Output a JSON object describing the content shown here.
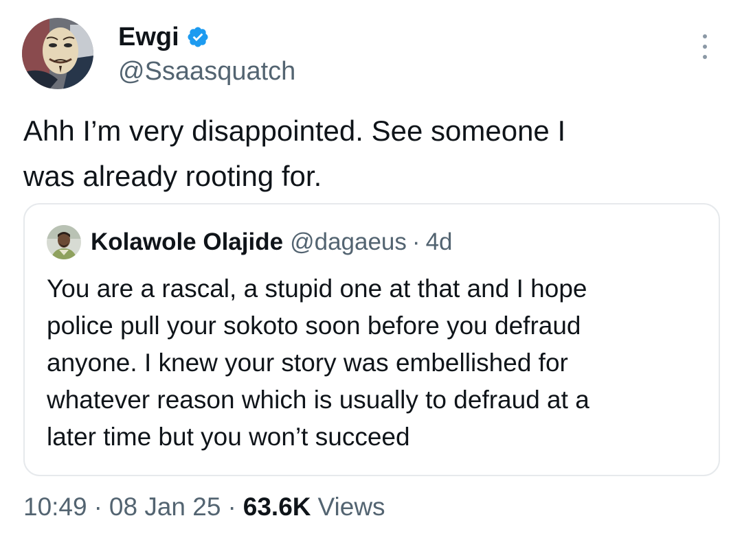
{
  "tweet": {
    "author": {
      "display_name": "Ewgi",
      "handle": "@Ssaasquatch",
      "verified": true,
      "avatar_icon": "guy-fawkes-mask-avatar"
    },
    "text_line1": "Ahh I’m very disappointed. See someone I",
    "text_line2": "was already rooting for.",
    "more_icon": "more-options-icon"
  },
  "quote": {
    "author_name": "Kolawole Olajide",
    "author_handle": "@dagaeus",
    "separator": "·",
    "time": "4d",
    "lines": [
      "You are a rascal, a stupid one at that and I hope",
      "police pull your sokoto soon before you defraud",
      "anyone. I knew your story was embellished for",
      "whatever reason which is usually to defraud at a",
      "later time but you won’t succeed"
    ]
  },
  "meta": {
    "time": "10:49",
    "separator": "·",
    "date": "08 Jan 25",
    "views_count": "63.6K",
    "views_label": "Views"
  },
  "colors": {
    "verified_blue": "#1d9bf0",
    "secondary_text": "#536471",
    "primary_text": "#0f1419",
    "border": "#e6e9ec"
  }
}
